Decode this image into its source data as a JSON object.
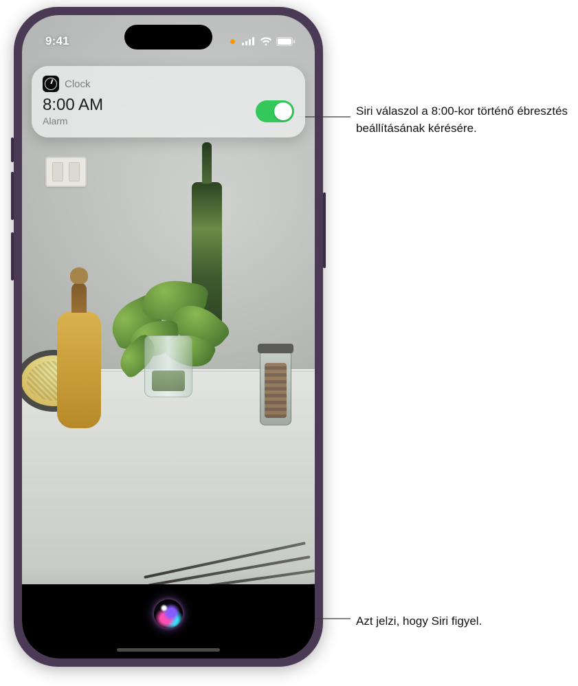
{
  "statusbar": {
    "time": "9:41"
  },
  "siri_card": {
    "app_name": "Clock",
    "time": "8:00 AM",
    "label": "Alarm"
  },
  "callouts": {
    "alarm_response": "Siri válaszol a 8:00-kor történő ébresztés beállításának kérésére.",
    "siri_listening": "Azt jelzi, hogy Siri figyel."
  }
}
